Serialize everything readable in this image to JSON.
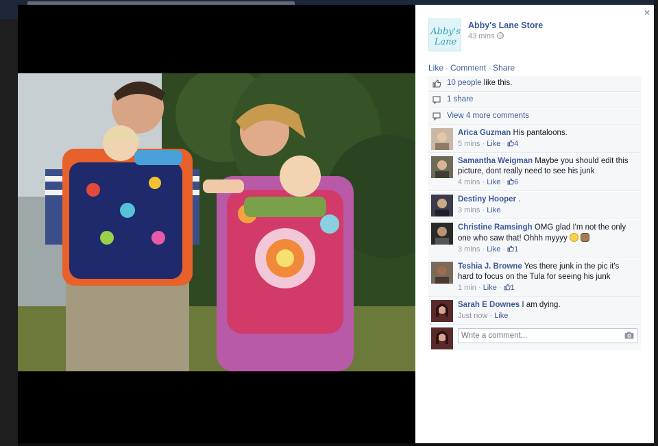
{
  "post": {
    "page_name": "Abby's Lane Store",
    "time": "43 mins",
    "logo_text_line1": "Abby's",
    "logo_text_line2": "Lane"
  },
  "actions": {
    "like": "Like",
    "comment": "Comment",
    "share": "Share",
    "separator": "·"
  },
  "stats": {
    "likes_link": "10 people",
    "likes_suffix": " like this.",
    "shares": "1 share",
    "more_comments": "View 4 more comments"
  },
  "comments": [
    {
      "author": "Arica Guzman",
      "text": "His pantaloons.",
      "time": "5 mins",
      "like": "Like",
      "likes": "4"
    },
    {
      "author": "Samantha Weigman",
      "text": "Maybe you should edit this picture, dont really need to see his junk",
      "time": "4 mins",
      "like": "Like",
      "likes": "6"
    },
    {
      "author": "Destiny Hooper",
      "text": ".",
      "time": "3 mins",
      "like": "Like",
      "likes": ""
    },
    {
      "author": "Christine Ramsingh",
      "text": "OMG glad I'm not the only one who saw that! Ohhh myyyy",
      "time": "3 mins",
      "like": "Like",
      "likes": "1"
    },
    {
      "author": "Teshia J. Browne",
      "text": "Yes there junk in the pic it's hard to focus on the Tula for seeing his junk",
      "time": "1 min",
      "like": "Like",
      "likes": "1"
    },
    {
      "author": "Sarah E Downes",
      "text": "I am dying.",
      "time": "Just now",
      "like": "Like",
      "likes": ""
    }
  ],
  "reply": {
    "placeholder": "Write a comment..."
  },
  "close": "×",
  "colors": {
    "link": "#3b5998",
    "meta": "#9197a3",
    "panel_bg": "#f6f7f9"
  }
}
